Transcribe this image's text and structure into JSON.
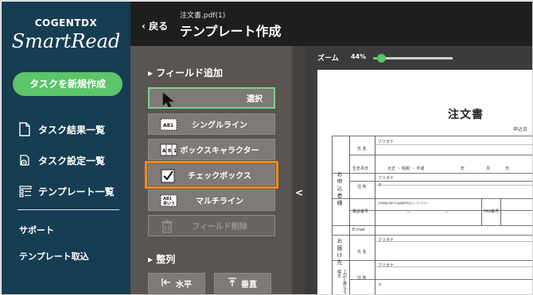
{
  "brand": {
    "top_text": "COGENT",
    "top_suffix": "DX",
    "name": "SmartRead"
  },
  "sidebar": {
    "new_task_label": "タスクを新規作成",
    "items": [
      {
        "label": "タスク結果一覧",
        "icon": "document-icon"
      },
      {
        "label": "タスク設定一覧",
        "icon": "settings-gear-icon"
      },
      {
        "label": "テンプレート一覧",
        "icon": "template-list-icon"
      }
    ],
    "support_label": "サポート",
    "import_label": "テンプレート取込"
  },
  "header": {
    "back_label": "‹ 戻る",
    "filename": "注文書.pdf(1)",
    "title": "テンプレート作成"
  },
  "panel": {
    "field_add_heading": "▸ フィールド追加",
    "buttons": [
      {
        "label": "選択",
        "icon": "cursor-arrow-icon",
        "state": "selected"
      },
      {
        "label": "シングルライン",
        "icon": "single-line-icon",
        "state": "normal"
      },
      {
        "label": "ボックスキャラクター",
        "icon": "box-character-icon",
        "state": "normal"
      },
      {
        "label": "チェックボックス",
        "icon": "checkbox-icon",
        "state": "highlighted"
      },
      {
        "label": "マルチライン",
        "icon": "multi-line-icon",
        "state": "normal"
      },
      {
        "label": "フィールド削除",
        "icon": "trash-icon",
        "state": "disabled"
      }
    ],
    "align_heading": "▸ 整列",
    "align_horizontal": "水平",
    "align_vertical": "垂直",
    "icon_text_single": "A81",
    "icon_text_multi": "あいう"
  },
  "collapse_label": "<",
  "viewer": {
    "zoom_label": "ズーム",
    "zoom_value": "44%",
    "zoom_fraction": 0.1
  },
  "document": {
    "title": "注文書",
    "date_label": "申込日",
    "section1_label": "お申込者様",
    "section2_label": "お届け先",
    "section3_label": "上記と異なる場合",
    "furigana": "フリガナ",
    "name": "氏 名",
    "birth": "生年月日",
    "era": "大正 ・ 昭和 ・ 平成",
    "year": "年",
    "month": "月",
    "day": "日",
    "address": "住 所",
    "postal": "〒",
    "phone": "電話番号",
    "phone_note": "日中連絡の取れる電話番号を記入してください",
    "fax": "FAX番号",
    "email": "E-mail",
    "dash": "－"
  },
  "colors": {
    "sidebar_bg": "#163d52",
    "accent_green": "#5cc469",
    "highlight_orange": "#f08a1e",
    "panel_bg": "#5a5552"
  }
}
